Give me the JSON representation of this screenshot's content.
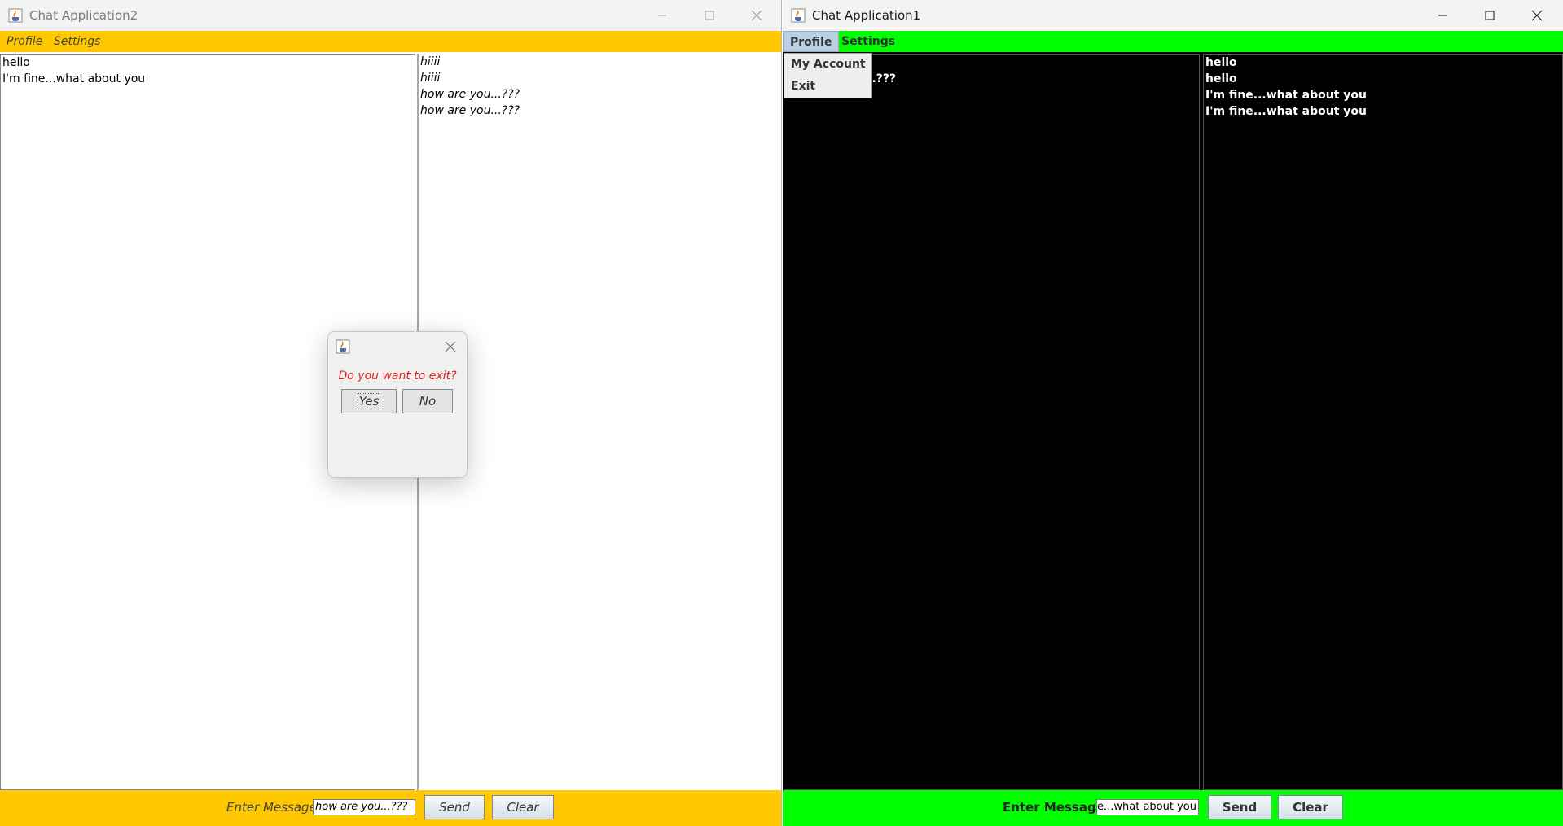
{
  "window2": {
    "title": "Chat Application2",
    "menu": [
      "Profile",
      "Settings"
    ],
    "left_messages": [
      "hello",
      "I'm fine...what about you"
    ],
    "right_messages": [
      "hiiii",
      "hiiii",
      "how are you...???",
      "how are you...???"
    ],
    "bottom": {
      "label": "Enter Message",
      "input_value": "how are you...???",
      "send": "Send",
      "clear": "Clear"
    },
    "theme_color": "#ffc800"
  },
  "window1": {
    "title": "Chat Application1",
    "menu": [
      "Profile",
      "Settings"
    ],
    "left_messages": [
      "how are you...???"
    ],
    "right_messages": [
      "hello",
      "hello",
      "I'm fine...what about you",
      "I'm fine...what about you"
    ],
    "bottom": {
      "label": "Enter Message",
      "input_value": "I'm fine...what about you",
      "send": "Send",
      "clear": "Clear"
    },
    "theme_color": "#00ff00",
    "profile_menu": [
      "My Account",
      "Exit"
    ]
  },
  "dialog": {
    "message": "Do you want to exit?",
    "yes": "Yes",
    "no": "No",
    "message_color": "#e0201c"
  },
  "icons": [
    "java-app-icon",
    "minimize-icon",
    "maximize-icon",
    "close-icon"
  ]
}
